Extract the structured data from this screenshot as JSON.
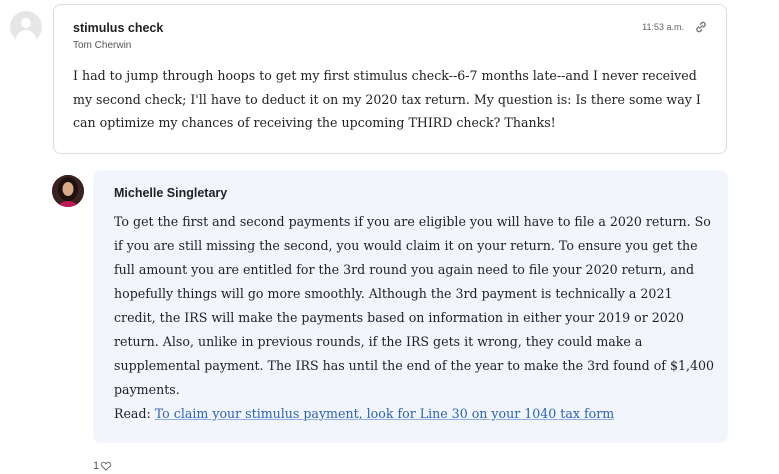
{
  "question": {
    "title": "stimulus check",
    "author": "Tom Cherwin",
    "time": "11:53 a.m.",
    "link_icon": "link-icon",
    "body": "I had to jump through hoops to get my first stimulus check--6-7 months late--and I never received my second check; I'll have to deduct it on my 2020 tax return. My question is: Is there some way I can optimize my chances of receiving the upcoming THIRD check? Thanks!"
  },
  "answer": {
    "name": "Michelle Singletary",
    "body": "To get the first and second payments if you are eligible you will have to file a 2020 return. So if you are still missing the second, you would claim it on your return. To ensure you get the full amount you are entitled for the 3rd round you again need to file your 2020 return, and hopefully things will go more smoothly. Although the 3rd payment is technically a 2021 credit, the IRS will make the payments based on information in either your 2019 or 2020 return. Also, unlike in previous rounds, if the IRS gets it wrong, they could make a supplemental payment. The IRS has until the end of the year to make the 3rd found of $1,400 payments.",
    "read_label": "Read:",
    "read_link": "To claim your stimulus payment, look for Line 30 on your 1040 tax form"
  },
  "likes": {
    "count": "1",
    "icon": "heart-outline-icon"
  },
  "colors": {
    "answer_background": "#f3f5fd",
    "link": "#2a63b3",
    "card_border": "#dcdcdc"
  }
}
